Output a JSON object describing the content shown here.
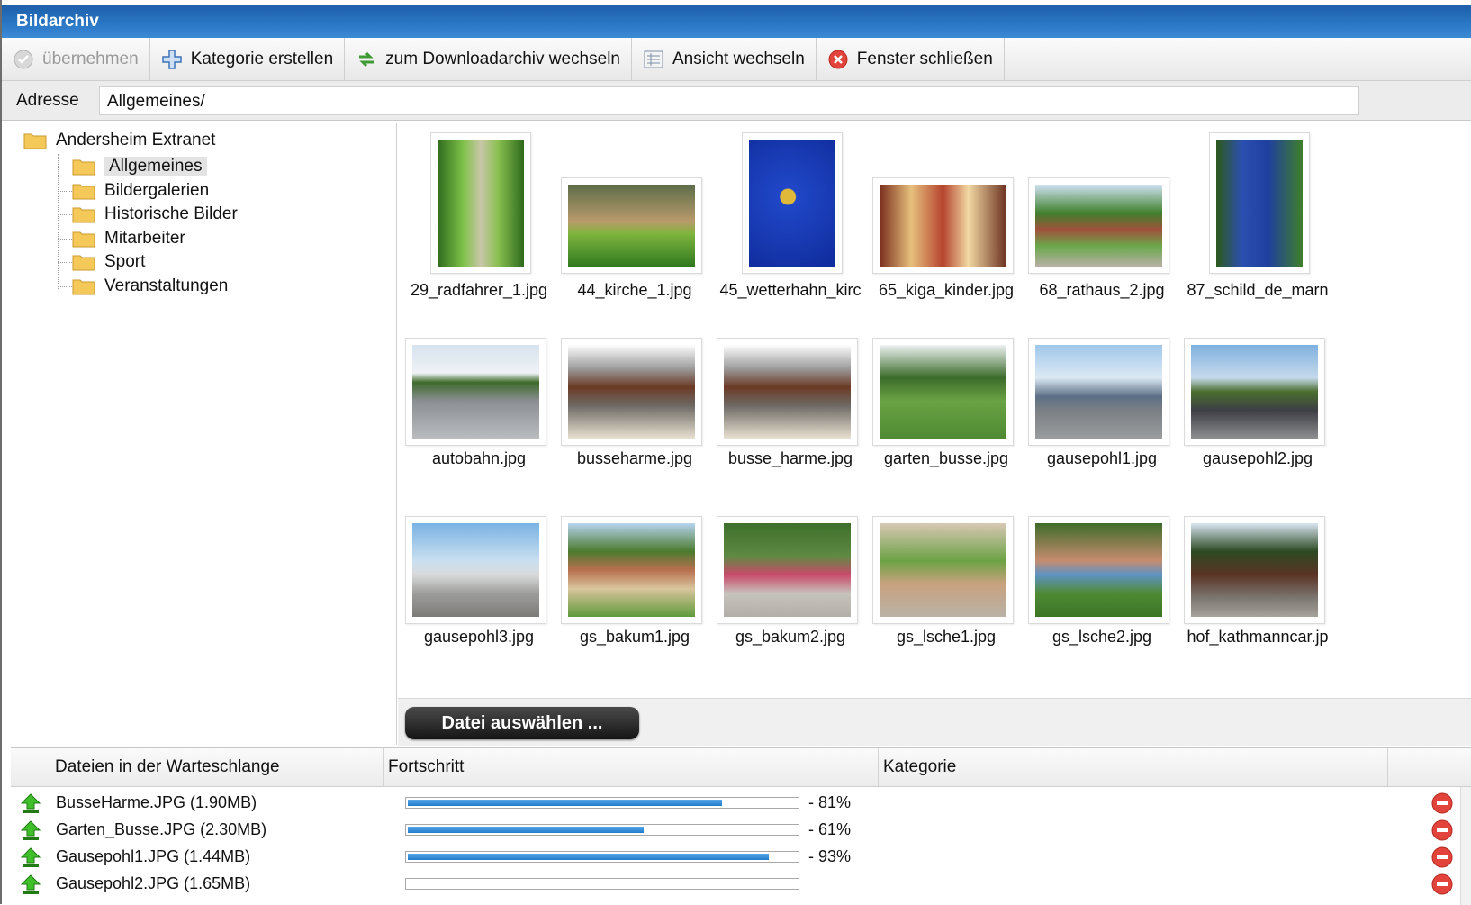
{
  "window": {
    "title": "Bildarchiv"
  },
  "toolbar": {
    "apply_label": "übernehmen",
    "create_category_label": "Kategorie erstellen",
    "switch_archive_label": "zum Downloadarchiv wechseln",
    "switch_view_label": "Ansicht wechseln",
    "close_label": "Fenster schließen"
  },
  "address": {
    "label": "Adresse",
    "value": "Allgemeines/"
  },
  "tree": {
    "root": "Andersheim Extranet",
    "children": [
      "Allgemeines",
      "Bildergalerien",
      "Historische Bilder",
      "Mitarbeiter",
      "Sport",
      "Veranstaltungen"
    ],
    "selected": "Allgemeines"
  },
  "gallery": {
    "images": [
      {
        "name": "29_radfahrer_1.jpg",
        "orientation": "portrait"
      },
      {
        "name": "44_kirche_1.jpg",
        "orientation": "landscape"
      },
      {
        "name": "45_wetterhahn_kirc",
        "orientation": "portrait"
      },
      {
        "name": "65_kiga_kinder.jpg",
        "orientation": "landscape"
      },
      {
        "name": "68_rathaus_2.jpg",
        "orientation": "landscape"
      },
      {
        "name": "87_schild_de_marn",
        "orientation": "portrait"
      },
      {
        "name": "autobahn.jpg",
        "orientation": "landscape"
      },
      {
        "name": "busseharme.jpg",
        "orientation": "landscape"
      },
      {
        "name": "busse_harme.jpg",
        "orientation": "landscape"
      },
      {
        "name": "garten_busse.jpg",
        "orientation": "landscape"
      },
      {
        "name": "gausepohl1.jpg",
        "orientation": "landscape"
      },
      {
        "name": "gausepohl2.jpg",
        "orientation": "landscape"
      },
      {
        "name": "gausepohl3.jpg",
        "orientation": "landscape"
      },
      {
        "name": "gs_bakum1.jpg",
        "orientation": "landscape"
      },
      {
        "name": "gs_bakum2.jpg",
        "orientation": "landscape"
      },
      {
        "name": "gs_lsche1.jpg",
        "orientation": "landscape"
      },
      {
        "name": "gs_lsche2.jpg",
        "orientation": "landscape"
      },
      {
        "name": "hof_kathmanncar.jp",
        "orientation": "landscape"
      }
    ],
    "select_file_label": "Datei auswählen ..."
  },
  "queue": {
    "headers": [
      "Dateien in der Warteschlange",
      "Fortschritt",
      "Kategorie"
    ],
    "rows": [
      {
        "file": "BusseHarme.JPG (1.90MB)",
        "progress": 81,
        "progress_label": "- 81%"
      },
      {
        "file": "Garten_Busse.JPG (2.30MB)",
        "progress": 61,
        "progress_label": "- 61%"
      },
      {
        "file": "Gausepohl1.JPG (1.44MB)",
        "progress": 93,
        "progress_label": "- 93%"
      },
      {
        "file": "Gausepohl2.JPG (1.65MB)",
        "progress": 1,
        "progress_label": ""
      }
    ]
  },
  "colors": {
    "titlebar": "#2a78c6",
    "progress_fill": "#1f7ccc",
    "folder": "#f4c95a"
  }
}
